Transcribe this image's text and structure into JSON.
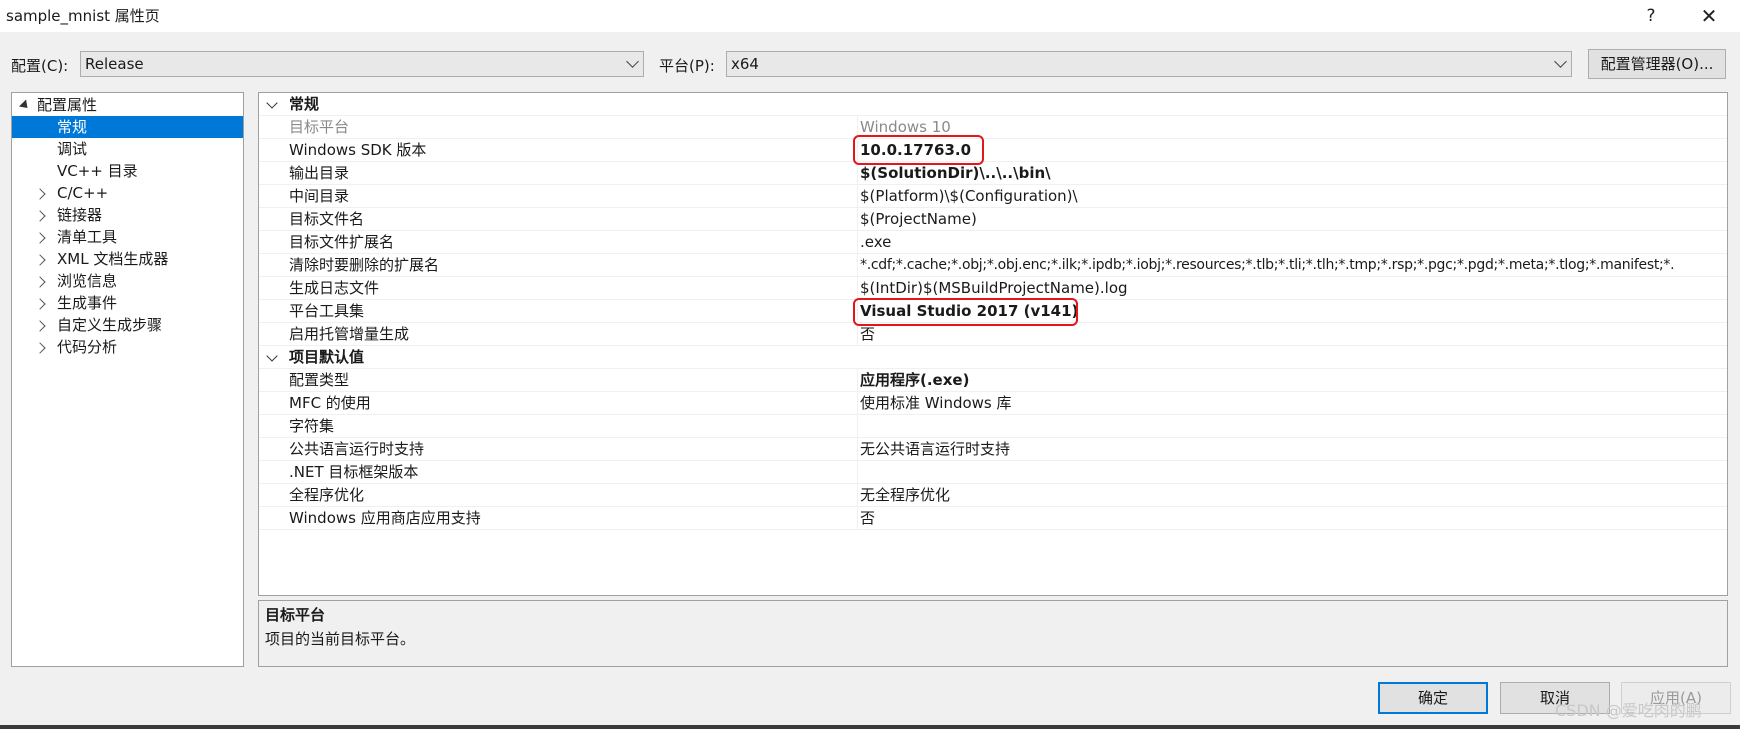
{
  "window": {
    "title": "sample_mnist 属性页",
    "help_label": "?",
    "close_label": "✕"
  },
  "toolbar": {
    "config_label": "配置(C):",
    "config_value": "Release",
    "platform_label": "平台(P):",
    "platform_value": "x64",
    "config_manager_label": "配置管理器(O)..."
  },
  "tree": {
    "root": "配置属性",
    "items": [
      "常规",
      "调试",
      "VC++ 目录",
      "C/C++",
      "链接器",
      "清单工具",
      "XML 文档生成器",
      "浏览信息",
      "生成事件",
      "自定义生成步骤",
      "代码分析"
    ]
  },
  "grid": {
    "cat1": "常规",
    "general": [
      {
        "name": "目标平台",
        "value": "Windows 10"
      },
      {
        "name": "Windows SDK 版本",
        "value": "10.0.17763.0"
      },
      {
        "name": "输出目录",
        "value": "$(SolutionDir)\\..\\..\\bin\\"
      },
      {
        "name": "中间目录",
        "value": "$(Platform)\\$(Configuration)\\"
      },
      {
        "name": "目标文件名",
        "value": "$(ProjectName)"
      },
      {
        "name": "目标文件扩展名",
        "value": ".exe"
      },
      {
        "name": "清除时要删除的扩展名",
        "value": "*.cdf;*.cache;*.obj;*.obj.enc;*.ilk;*.ipdb;*.iobj;*.resources;*.tlb;*.tli;*.tlh;*.tmp;*.rsp;*.pgc;*.pgd;*.meta;*.tlog;*.manifest;*."
      },
      {
        "name": "生成日志文件",
        "value": "$(IntDir)$(MSBuildProjectName).log"
      },
      {
        "name": "平台工具集",
        "value": "Visual Studio 2017 (v141)"
      },
      {
        "name": "启用托管增量生成",
        "value": "否"
      }
    ],
    "cat2": "项目默认值",
    "defaults": [
      {
        "name": "配置类型",
        "value": "应用程序(.exe)"
      },
      {
        "name": "MFC 的使用",
        "value": "使用标准 Windows 库"
      },
      {
        "name": "字符集",
        "value": ""
      },
      {
        "name": "公共语言运行时支持",
        "value": "无公共语言运行时支持"
      },
      {
        "name": ".NET 目标框架版本",
        "value": ""
      },
      {
        "name": "全程序优化",
        "value": "无全程序优化"
      },
      {
        "name": "Windows 应用商店应用支持",
        "value": "否"
      }
    ]
  },
  "description": {
    "title": "目标平台",
    "text": "项目的当前目标平台。"
  },
  "buttons": {
    "ok": "确定",
    "cancel": "取消",
    "apply": "应用(A)"
  },
  "watermark": "CSDN @爱吃肉的鹏",
  "colors": {
    "selection": "#0078d7",
    "highlight_box": "#e8141c"
  }
}
